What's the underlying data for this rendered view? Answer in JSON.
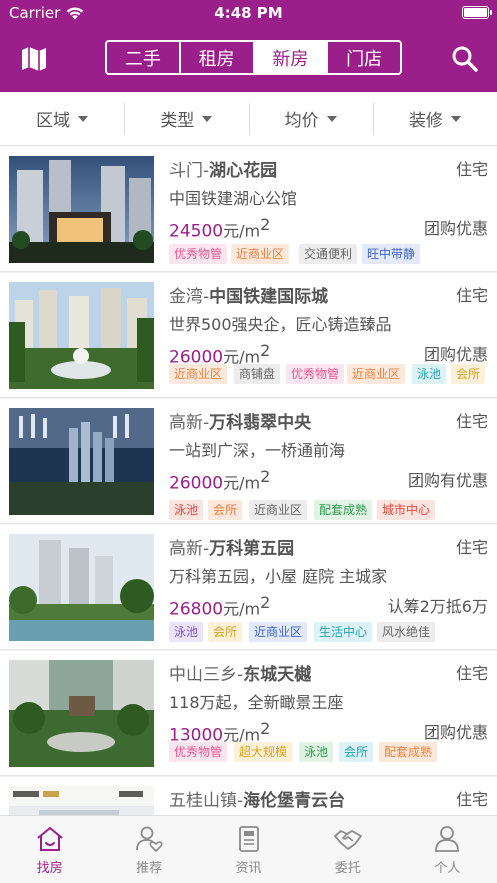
{
  "status_bar": {
    "carrier": "Carrier",
    "time": "4:48 PM"
  },
  "header": {
    "segments": [
      {
        "label": "二手",
        "active": false
      },
      {
        "label": "租房",
        "active": false
      },
      {
        "label": "新房",
        "active": true
      },
      {
        "label": "门店",
        "active": false
      }
    ]
  },
  "filters": [
    {
      "label": "区域"
    },
    {
      "label": "类型"
    },
    {
      "label": "均价"
    },
    {
      "label": "装修"
    }
  ],
  "listings": [
    {
      "area": "斗门-",
      "name": "湖心花园",
      "type": "住宅",
      "subtitle": "中国铁建湖心公馆",
      "price": "24500",
      "unit": "元/m",
      "unit_sup": "2",
      "promo": "团购优惠",
      "tags": [
        "优秀物管",
        "近商业区",
        "交通便利",
        "旺中带静"
      ]
    },
    {
      "area": "金湾-",
      "name": "中国铁建国际城",
      "type": "住宅",
      "subtitle": "世界500强央企，匠心铸造臻品",
      "price": "26000",
      "unit": "元/m",
      "unit_sup": "2",
      "promo": "团购优惠",
      "tags": [
        "近商业区",
        "商铺盘",
        "优秀物管",
        "近商业区",
        "泳池",
        "会所"
      ]
    },
    {
      "area": "高新-",
      "name": "万科翡翠中央",
      "type": "住宅",
      "subtitle": "一站到广深，一桥通前海",
      "price": "26000",
      "unit": "元/m",
      "unit_sup": "2",
      "promo": "团购有优惠",
      "tags": [
        "泳池",
        "会所",
        "近商业区",
        "配套成熟",
        "城市中心"
      ]
    },
    {
      "area": "高新-",
      "name": "万科第五园",
      "type": "住宅",
      "subtitle": "万科第五园，小屋  庭院  主城家",
      "price": "26800",
      "unit": "元/m",
      "unit_sup": "2",
      "promo": "认筹2万抵6万",
      "tags": [
        "泳池",
        "会所",
        "近商业区",
        "生活中心",
        "风水绝佳"
      ]
    },
    {
      "area": "中山三乡-",
      "name": "东城天樾",
      "type": "住宅",
      "subtitle": "118万起，全新瞰景王座",
      "price": "13000",
      "unit": "元/m",
      "unit_sup": "2",
      "promo": "团购优惠",
      "tags": [
        "优秀物管",
        "超大规模",
        "泳池",
        "会所",
        "配套成熟"
      ]
    },
    {
      "area": "五桂山镇-",
      "name": "海伦堡青云台",
      "type": "住宅",
      "subtitle": "",
      "price": "",
      "unit": "",
      "unit_sup": "",
      "promo": "",
      "tags": []
    }
  ],
  "tabbar": [
    {
      "label": "找房",
      "icon": "house-icon",
      "active": true
    },
    {
      "label": "推荐",
      "icon": "person-heart-icon",
      "active": false
    },
    {
      "label": "资讯",
      "icon": "news-icon",
      "active": false
    },
    {
      "label": "委托",
      "icon": "handshake-icon",
      "active": false
    },
    {
      "label": "个人",
      "icon": "user-icon",
      "active": false
    }
  ],
  "colors": {
    "brand": "#9b1f8a",
    "tag_pink": "#e8548f",
    "tag_orange": "#ef7f3a",
    "tag_gray": "#666666",
    "tag_blue": "#3d64c7",
    "tag_teal": "#1ea6b8",
    "tag_gold": "#d9a21e",
    "tag_red": "#e04a3a",
    "tag_purple": "#7d52c8"
  }
}
